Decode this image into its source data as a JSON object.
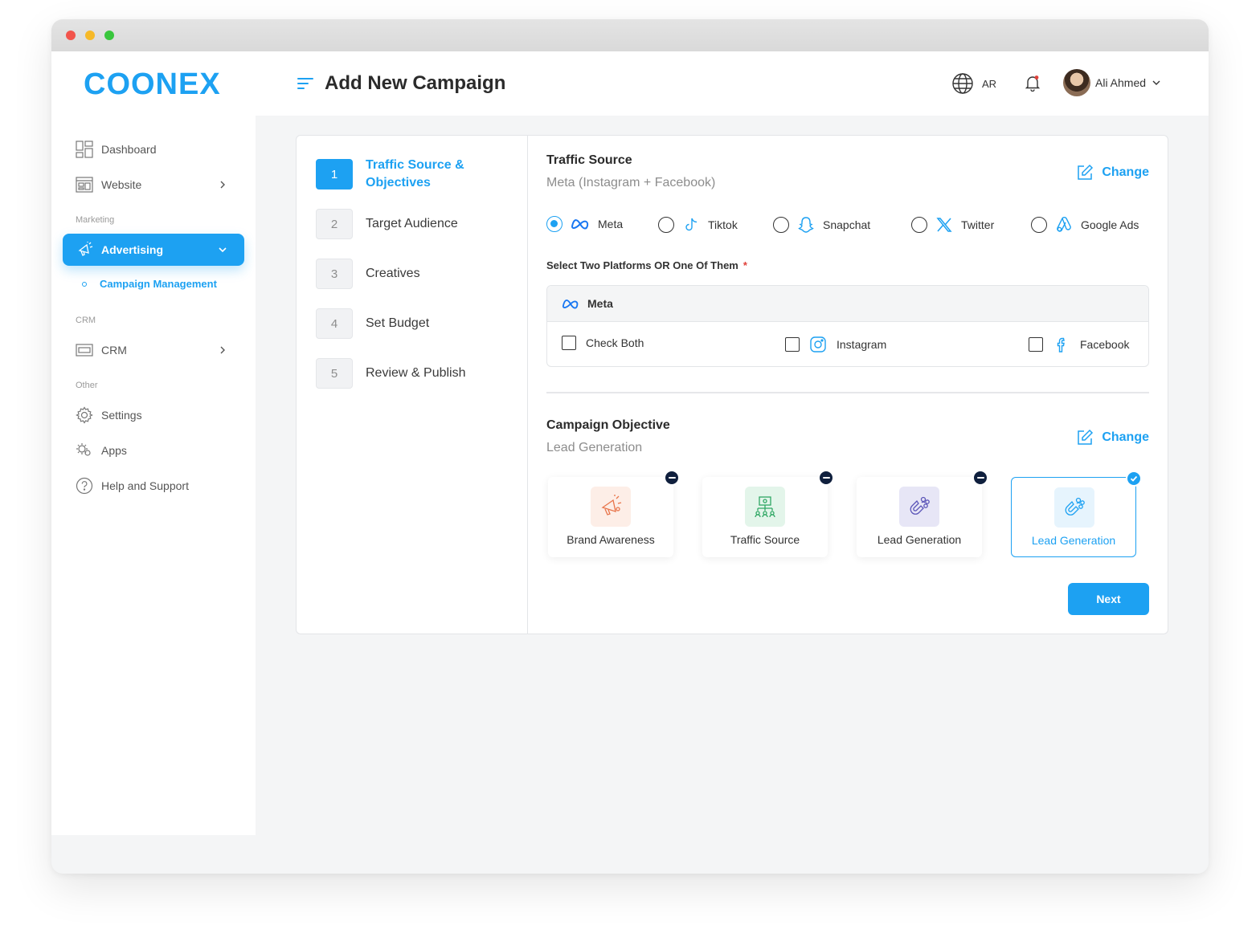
{
  "brand": {
    "logo_text": "COONEX",
    "accent": "#1da1f2"
  },
  "header": {
    "title": "Add New Campaign",
    "language": "AR",
    "user_name": "Ali Ahmed"
  },
  "sidebar": {
    "items": [
      {
        "label": "Dashboard",
        "icon": "dashboard-icon"
      },
      {
        "label": "Website",
        "icon": "website-icon"
      }
    ],
    "sections": {
      "marketing": "Marketing",
      "crm": "CRM",
      "other": "Other"
    },
    "active": {
      "label": "Advertising",
      "icon": "megaphone-icon"
    },
    "subitem": "Campaign Management",
    "crm_item": "CRM",
    "other_items": [
      {
        "label": "Settings",
        "icon": "gear-icon"
      },
      {
        "label": "Apps",
        "icon": "apps-icon"
      },
      {
        "label": "Help and Support",
        "icon": "help-icon"
      }
    ]
  },
  "steps": [
    {
      "num": "1",
      "label": "Traffic Source & Objectives",
      "active": true
    },
    {
      "num": "2",
      "label": "Target Audience"
    },
    {
      "num": "3",
      "label": "Creatives"
    },
    {
      "num": "4",
      "label": "Set Budget"
    },
    {
      "num": "5",
      "label": "Review & Publish"
    }
  ],
  "traffic": {
    "title": "Traffic Source",
    "value": "Meta (Instagram + Facebook)",
    "change": "Change",
    "platforms": [
      "Meta",
      "Tiktok",
      "Snapchat",
      "Twitter",
      "Google Ads"
    ],
    "selected": "Meta",
    "select_label": "Select Two Platforms OR One Of Them",
    "required_mark": "*",
    "group_title": "Meta",
    "options": [
      "Check Both",
      "Instagram",
      "Facebook"
    ]
  },
  "objective": {
    "title": "Campaign Objective",
    "value": "Lead Generation",
    "change": "Change",
    "cards": [
      {
        "label": "Brand Awareness",
        "icon": "megaphone-icon"
      },
      {
        "label": "Traffic Source",
        "icon": "network-icon"
      },
      {
        "label": "Lead Generation",
        "icon": "magnet-icon"
      },
      {
        "label": "Lead Generation",
        "icon": "magnet-icon",
        "selected": true
      }
    ]
  },
  "actions": {
    "next": "Next"
  }
}
